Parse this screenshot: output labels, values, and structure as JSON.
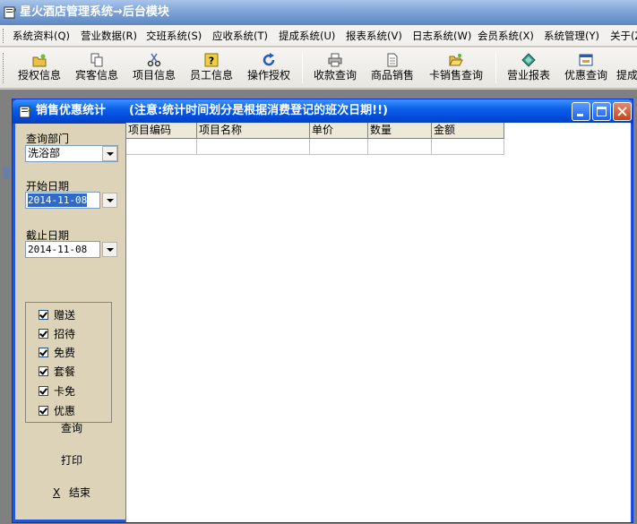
{
  "app": {
    "title": "星火酒店管理系统→后台模块"
  },
  "menu": {
    "items": [
      {
        "label": "系统资料(Q)"
      },
      {
        "label": "营业数据(R)"
      },
      {
        "label": "交班系统(S)"
      },
      {
        "label": "应收系统(T)"
      },
      {
        "label": "提成系统(U)"
      },
      {
        "label": "报表系统(V)"
      },
      {
        "label": "日志系统(W)"
      },
      {
        "label": "会员系统(X)"
      },
      {
        "label": "系统管理(Y)"
      },
      {
        "label": "关于(Z)"
      }
    ]
  },
  "toolbar": {
    "buttons": [
      {
        "label": "授权信息",
        "icon": "folder-key-icon"
      },
      {
        "label": "宾客信息",
        "icon": "copy-icon"
      },
      {
        "label": "项目信息",
        "icon": "scissors-icon"
      },
      {
        "label": "员工信息",
        "icon": "help-icon"
      },
      {
        "label": "操作授权",
        "icon": "refresh-icon"
      },
      {
        "label": "收款查询",
        "icon": "printer-icon"
      },
      {
        "label": "商品销售",
        "icon": "document-icon"
      },
      {
        "label": "卡销售查询",
        "icon": "open-folder-icon"
      },
      {
        "label": "营业报表",
        "icon": "diamond-icon"
      },
      {
        "label": "优惠查询",
        "icon": "window-icon"
      },
      {
        "label": "提成"
      }
    ]
  },
  "window": {
    "title": "销售优惠统计",
    "note": "(注意:统计时间划分是根据消费登记的班次日期!!)"
  },
  "filters": {
    "department_label": "查询部门",
    "department_value": "洗浴部",
    "start_label": "开始日期",
    "start_value": "2014-11-08",
    "end_label": "截止日期",
    "end_value": "2014-11-08"
  },
  "checkboxes": [
    {
      "label": "赠送",
      "checked": true
    },
    {
      "label": "招待",
      "checked": true
    },
    {
      "label": "免费",
      "checked": true
    },
    {
      "label": "套餐",
      "checked": true
    },
    {
      "label": "卡免",
      "checked": true
    },
    {
      "label": "优惠",
      "checked": true
    }
  ],
  "actions": {
    "query": "查询",
    "print": "打印",
    "exit_key": "X",
    "exit": "结束"
  },
  "grid": {
    "columns": [
      "项目编码",
      "项目名称",
      "单价",
      "数量",
      "金额"
    ]
  }
}
